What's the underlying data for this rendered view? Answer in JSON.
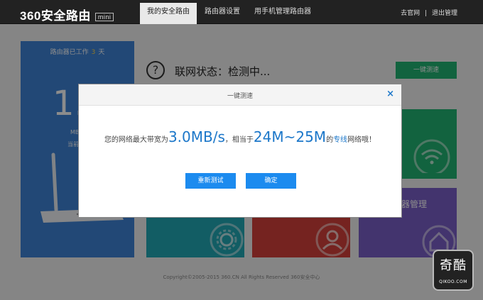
{
  "app": {
    "logo_text": "360安全路由",
    "logo_badge": "mini"
  },
  "nav": {
    "tabs": [
      {
        "label": "我的安全路由",
        "active": true
      },
      {
        "label": "路由器设置",
        "active": false
      },
      {
        "label": "用手机管理路由器",
        "active": false
      }
    ],
    "official_site": "去官网",
    "separator": "|",
    "logout": "退出管理"
  },
  "left_panel": {
    "title_prefix": "路由器已工作",
    "days": "3",
    "title_suffix": "天",
    "big_value": "1.",
    "unit": "MB",
    "sub": "当前"
  },
  "status": {
    "icon": "question-circle-icon",
    "label": "联网状态：检测中..."
  },
  "speed_test_button": "一键测速",
  "tiles": {
    "purple_label": "器管理"
  },
  "footer": "Copyright©2005-2015 360.CN All Rights Reserved 360安全中心",
  "modal": {
    "title": "一键测速",
    "close_icon": "×",
    "msg_1": "您的网络最大带宽为",
    "bandwidth": "3.0MB/s",
    "msg_2": "，相当于",
    "equivalent": "24M~25M",
    "msg_3": "的",
    "line_type": "专线",
    "msg_4": "网络哦！",
    "retest_button": "重新测试",
    "confirm_button": "确定"
  },
  "watermark": {
    "big": "奇酷",
    "small": "QIKOO.COM"
  },
  "colors": {
    "accent_blue": "#1c8bef",
    "panel_blue": "#3f84d7",
    "green": "#22b573",
    "purple": "#7a5fc9",
    "teal": "#22a9b6",
    "red": "#d6403b"
  }
}
